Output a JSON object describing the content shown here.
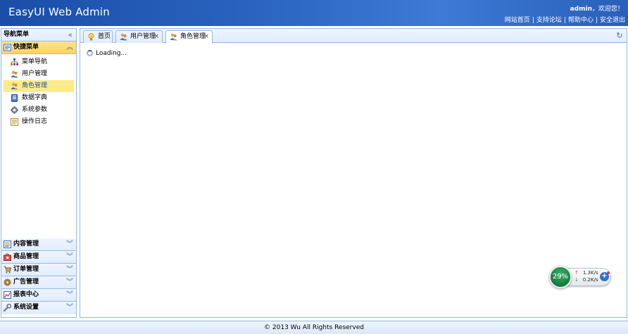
{
  "header": {
    "title": "EasyUI Web Admin",
    "user": "admin",
    "welcome": "，欢迎您！",
    "links": [
      "网站首页",
      "支持论坛",
      "帮助中心",
      "安全退出"
    ],
    "separator": "|"
  },
  "nav": {
    "title": "导航菜单",
    "quick_menu": {
      "label": "快捷菜单",
      "items": [
        {
          "label": "菜单导航",
          "icon": "sitemap-icon"
        },
        {
          "label": "用户管理",
          "icon": "users-icon"
        },
        {
          "label": "角色管理",
          "icon": "role-icon",
          "selected": true
        },
        {
          "label": "数据字典",
          "icon": "database-icon"
        },
        {
          "label": "系统参数",
          "icon": "gear-icon"
        },
        {
          "label": "操作日志",
          "icon": "log-icon"
        }
      ]
    },
    "sections": [
      {
        "label": "内容管理",
        "icon": "content-icon"
      },
      {
        "label": "商品管理",
        "icon": "goods-icon"
      },
      {
        "label": "订单管理",
        "icon": "cart-icon"
      },
      {
        "label": "广告管理",
        "icon": "ad-icon"
      },
      {
        "label": "报表中心",
        "icon": "chart-icon"
      },
      {
        "label": "系统设置",
        "icon": "wrench-icon"
      }
    ]
  },
  "tabs": [
    {
      "label": "首页",
      "icon": "bulb-icon",
      "closable": false
    },
    {
      "label": "用户管理",
      "icon": "users-icon",
      "closable": true
    },
    {
      "label": "角色管理",
      "icon": "role-icon",
      "closable": true,
      "active": true
    }
  ],
  "content": {
    "loading": "Loading..."
  },
  "footer": {
    "text": "© 2013 Wu All Rights Reserved"
  },
  "network_widget": {
    "percent": "29%",
    "upload": "1.3K/s",
    "download": "0.2K/s"
  },
  "colors": {
    "header": "#2a63c0",
    "border": "#95b8e7",
    "active_menu": "#ffd463",
    "selected_item": "#fbec88"
  }
}
